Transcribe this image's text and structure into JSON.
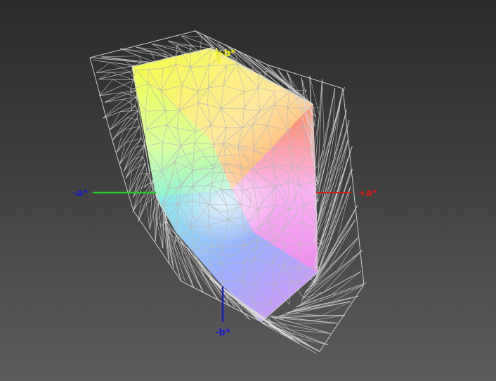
{
  "gamut_view": {
    "axes": {
      "a_negative": {
        "label": "-a*",
        "color": "#1a1acc",
        "line_color": "#22cc22"
      },
      "a_positive": {
        "label": "+a*",
        "color": "#e01818",
        "line_color": "#e01818"
      },
      "b_positive": {
        "label": "+b*",
        "color": "#f0f000",
        "line_color": "#f0f000"
      },
      "b_negative": {
        "label": "-b*",
        "color": "#1a1acc",
        "line_color": "#1a1acc"
      }
    },
    "colors": {
      "wireframe": "#d8d8d8",
      "inner_mesh": "#b8b8b8",
      "yellow": "#f2ff40",
      "orange": "#ff9a6a",
      "cyan": "#7ff0e0",
      "blue": "#8a9bff",
      "magenta": "#f49cf2",
      "pink": "#f8c0ee"
    }
  }
}
